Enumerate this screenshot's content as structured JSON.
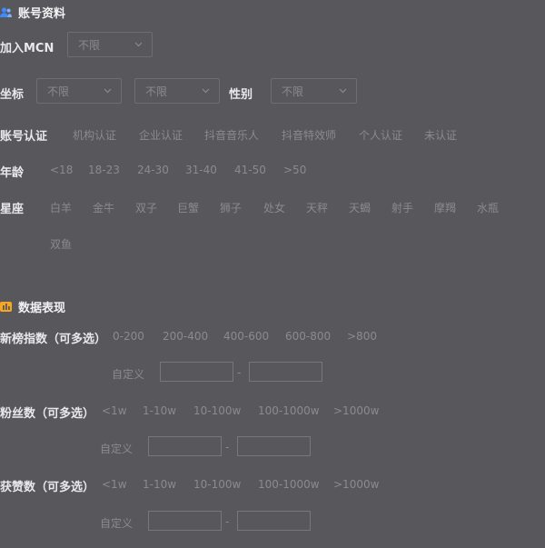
{
  "account": {
    "title": "账号资料",
    "mcn": {
      "label": "加入MCN",
      "value": "不限"
    },
    "location": {
      "label": "坐标",
      "province": "不限",
      "city": "不限"
    },
    "gender": {
      "label": "性别",
      "value": "不限"
    },
    "verification": {
      "label": "账号认证",
      "options": [
        "机构认证",
        "企业认证",
        "抖音音乐人",
        "抖音特效师",
        "个人认证",
        "未认证"
      ]
    },
    "age": {
      "label": "年龄",
      "options": [
        "<18",
        "18-23",
        "24-30",
        "31-40",
        "41-50",
        ">50"
      ]
    },
    "zodiac": {
      "label": "星座",
      "options": [
        "白羊",
        "金牛",
        "双子",
        "巨蟹",
        "狮子",
        "处女",
        "天秤",
        "天蝎",
        "射手",
        "摩羯",
        "水瓶",
        "双鱼"
      ]
    }
  },
  "performance": {
    "title": "数据表现",
    "ranking": {
      "label": "新榜指数（可多选）",
      "options": [
        "0-200",
        "200-400",
        "400-600",
        "600-800",
        ">800"
      ],
      "custom_label": "自定义",
      "dash": "-"
    },
    "fans": {
      "label": "粉丝数（可多选）",
      "options": [
        "<1w",
        "1-10w",
        "10-100w",
        "100-1000w",
        ">1000w"
      ],
      "custom_label": "自定义",
      "dash": "-"
    },
    "likes": {
      "label": "获赞数（可多选）",
      "options": [
        "<1w",
        "1-10w",
        "10-100w",
        "100-1000w",
        ">1000w"
      ],
      "custom_label": "自定义",
      "dash": "-"
    }
  },
  "colors": {
    "background": "#58575c",
    "account_icon": "#3d8bff",
    "performance_icon": "#f5a623"
  }
}
